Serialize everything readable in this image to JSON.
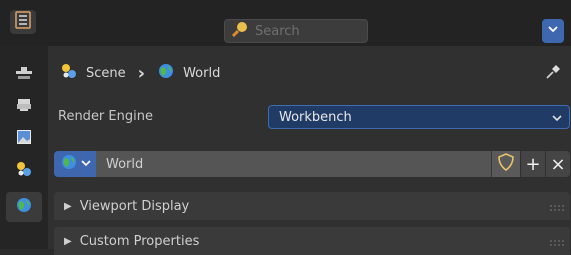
{
  "header": {
    "search_placeholder": "Search"
  },
  "sidebar": {
    "tabs": [
      {
        "name": "tool"
      },
      {
        "name": "render"
      },
      {
        "name": "output"
      },
      {
        "name": "scene"
      },
      {
        "name": "world",
        "active": true
      }
    ]
  },
  "breadcrumb": {
    "scene": "Scene",
    "separator": "›",
    "world": "World"
  },
  "render_engine": {
    "label": "Render Engine",
    "value": "Workbench"
  },
  "world_datablock": {
    "name": "World",
    "plus": "+",
    "close": "×"
  },
  "panels": [
    {
      "label": "Viewport Display"
    },
    {
      "label": "Custom Properties"
    }
  ],
  "colors": {
    "accent": "#3e67b0",
    "background": "#303030"
  }
}
